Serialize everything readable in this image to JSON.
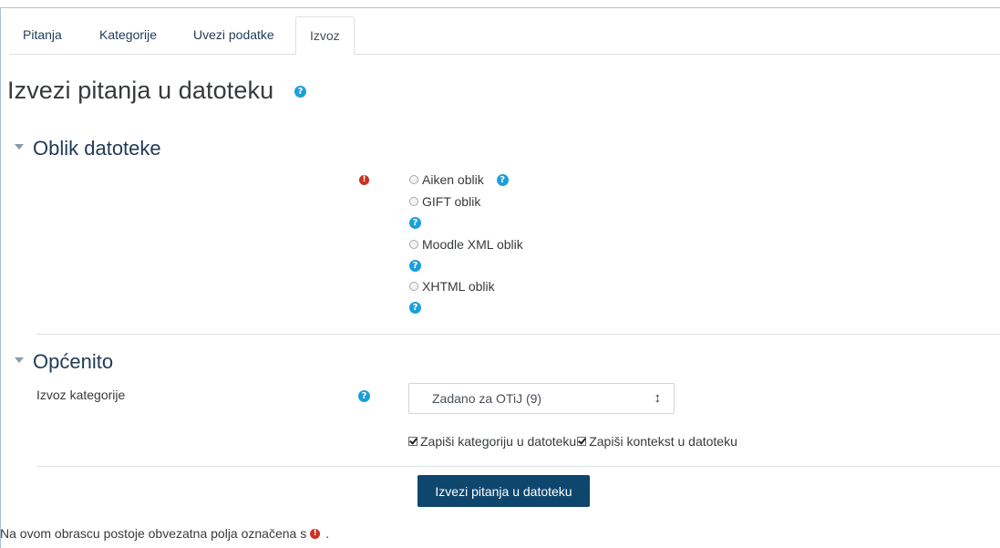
{
  "tabs": [
    {
      "label": "Pitanja"
    },
    {
      "label": "Kategorije"
    },
    {
      "label": "Uvezi podatke"
    },
    {
      "label": "Izvoz"
    }
  ],
  "page_title": "Izvezi pitanja u datoteku",
  "sections": {
    "file_format": {
      "title": "Oblik datoteke",
      "options": [
        {
          "label": "Aiken oblik"
        },
        {
          "label": "GIFT oblik"
        },
        {
          "label": "Moodle XML oblik"
        },
        {
          "label": "XHTML oblik"
        }
      ]
    },
    "general": {
      "title": "Općenito",
      "category_label": "Izvoz kategorije",
      "category_value": "Zadano za OTiJ (9)",
      "checkbox_category": "Zapiši kategoriju u datoteku",
      "checkbox_context": "Zapiši kontekst u datoteku"
    }
  },
  "submit_label": "Izvezi pitanja u datoteku",
  "footnote": {
    "text": "Na ovom obrascu postoje obvezatna polja označena s",
    "suffix": "."
  },
  "icons": {
    "help": "question-circle-icon",
    "required": "exclamation-circle-icon"
  },
  "colors": {
    "link": "#1f3b57",
    "primary_button": "#0f466e",
    "help_icon": "#1d9fd9",
    "required_icon": "#ca3120"
  }
}
